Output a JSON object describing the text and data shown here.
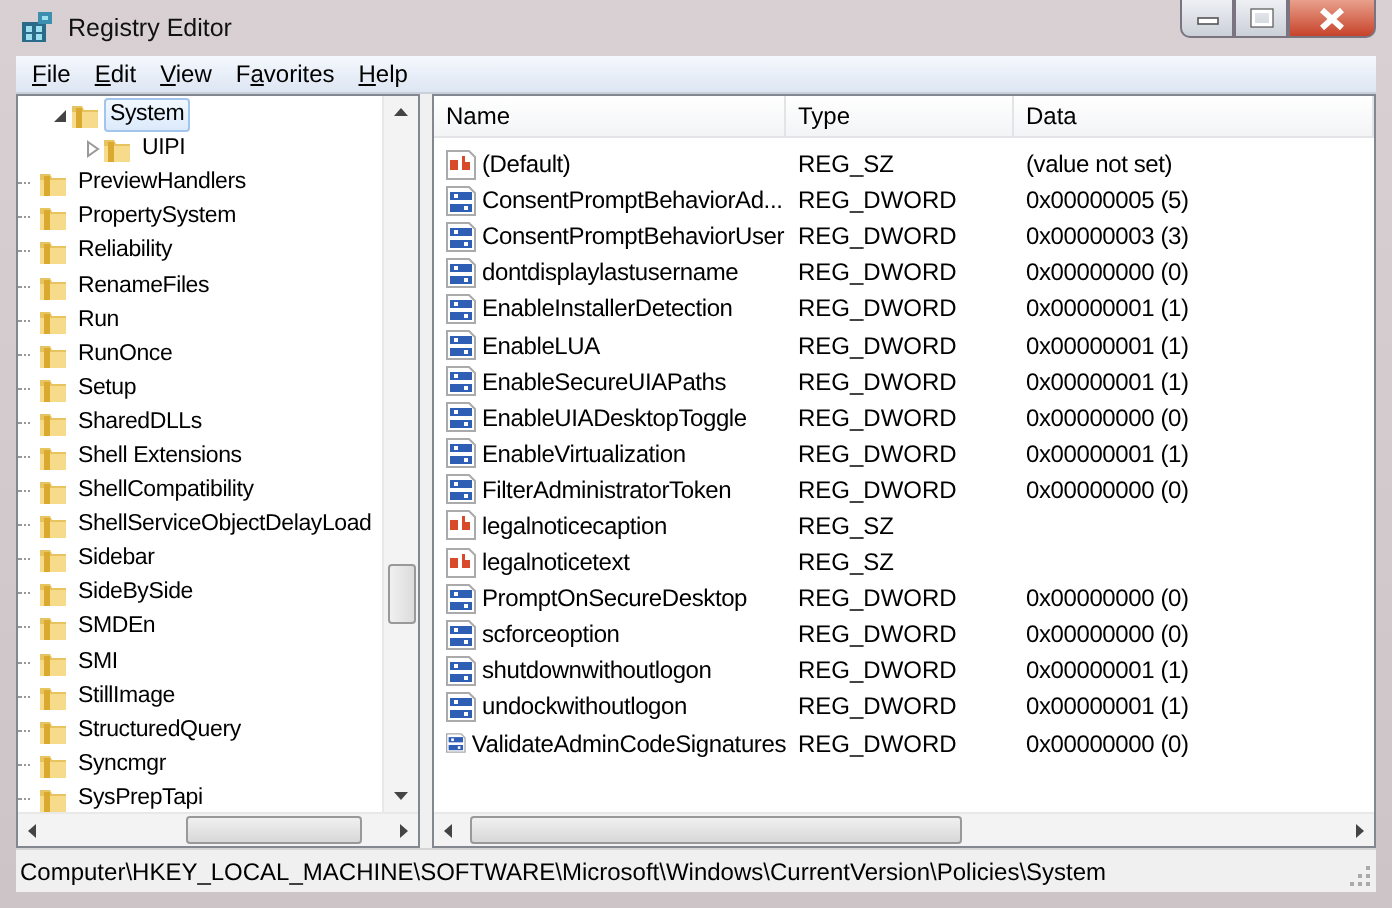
{
  "window": {
    "title": "Registry Editor"
  },
  "menu": [
    {
      "access_key": "F",
      "after": "ile"
    },
    {
      "access_key": "E",
      "after": "dit"
    },
    {
      "access_key": "V",
      "after": "iew"
    },
    {
      "before": "F",
      "access_key": "a",
      "after": "vorites"
    },
    {
      "access_key": "H",
      "after": "elp"
    }
  ],
  "tree": {
    "nested_items": [
      {
        "label": "System",
        "expanded": true,
        "selected": true,
        "children": [
          {
            "label": "UIPI",
            "expanded": false,
            "selected": false
          }
        ]
      }
    ],
    "items": [
      {
        "label": "PreviewHandlers",
        "selected": false
      },
      {
        "label": "PropertySystem",
        "selected": false
      },
      {
        "label": "Reliability",
        "selected": false
      },
      {
        "label": "RenameFiles",
        "selected": false
      },
      {
        "label": "Run",
        "selected": false
      },
      {
        "label": "RunOnce",
        "selected": false
      },
      {
        "label": "Setup",
        "selected": false
      },
      {
        "label": "SharedDLLs",
        "selected": false
      },
      {
        "label": "Shell Extensions",
        "selected": false
      },
      {
        "label": "ShellCompatibility",
        "selected": false
      },
      {
        "label": "ShellServiceObjectDelayLoad",
        "selected": false
      },
      {
        "label": "Sidebar",
        "selected": false
      },
      {
        "label": "SideBySide",
        "selected": false
      },
      {
        "label": "SMDEn",
        "selected": false
      },
      {
        "label": "SMI",
        "selected": false
      },
      {
        "label": "StillImage",
        "selected": false
      },
      {
        "label": "StructuredQuery",
        "selected": false
      },
      {
        "label": "Syncmgr",
        "selected": false
      },
      {
        "label": "SysPrepTapi",
        "selected": false
      }
    ]
  },
  "table": {
    "columns": [
      "Name",
      "Type",
      "Data"
    ],
    "rows": [
      {
        "kind": "string",
        "name": "(Default)",
        "type": "REG_SZ",
        "data": "(value not set)"
      },
      {
        "kind": "binary",
        "name": "ConsentPromptBehaviorAd...",
        "type": "REG_DWORD",
        "data": "0x00000005 (5)"
      },
      {
        "kind": "binary",
        "name": "ConsentPromptBehaviorUser",
        "type": "REG_DWORD",
        "data": "0x00000003 (3)"
      },
      {
        "kind": "binary",
        "name": "dontdisplaylastusername",
        "type": "REG_DWORD",
        "data": "0x00000000 (0)"
      },
      {
        "kind": "binary",
        "name": "EnableInstallerDetection",
        "type": "REG_DWORD",
        "data": "0x00000001 (1)"
      },
      {
        "kind": "binary",
        "name": "EnableLUA",
        "type": "REG_DWORD",
        "data": "0x00000001 (1)"
      },
      {
        "kind": "binary",
        "name": "EnableSecureUIAPaths",
        "type": "REG_DWORD",
        "data": "0x00000001 (1)"
      },
      {
        "kind": "binary",
        "name": "EnableUIADesktopToggle",
        "type": "REG_DWORD",
        "data": "0x00000000 (0)"
      },
      {
        "kind": "binary",
        "name": "EnableVirtualization",
        "type": "REG_DWORD",
        "data": "0x00000001 (1)"
      },
      {
        "kind": "binary",
        "name": "FilterAdministratorToken",
        "type": "REG_DWORD",
        "data": "0x00000000 (0)"
      },
      {
        "kind": "string",
        "name": "legalnoticecaption",
        "type": "REG_SZ"
      },
      {
        "kind": "string",
        "name": "legalnoticetext",
        "type": "REG_SZ"
      },
      {
        "kind": "binary",
        "name": "PromptOnSecureDesktop",
        "type": "REG_DWORD",
        "data": "0x00000000 (0)"
      },
      {
        "kind": "binary",
        "name": "scforceoption",
        "type": "REG_DWORD",
        "data": "0x00000000 (0)"
      },
      {
        "kind": "binary",
        "name": "shutdownwithoutlogon",
        "type": "REG_DWORD",
        "data": "0x00000001 (1)"
      },
      {
        "kind": "binary",
        "name": "undockwithoutlogon",
        "type": "REG_DWORD",
        "data": "0x00000001 (1)"
      },
      {
        "kind": "binary",
        "name": "ValidateAdminCodeSignatures",
        "type": "REG_DWORD",
        "data": "0x00000000 (0)"
      }
    ]
  },
  "status_bar": "Computer\\HKEY_LOCAL_MACHINE\\SOFTWARE\\Microsoft\\Windows\\CurrentVersion\\Policies\\System"
}
